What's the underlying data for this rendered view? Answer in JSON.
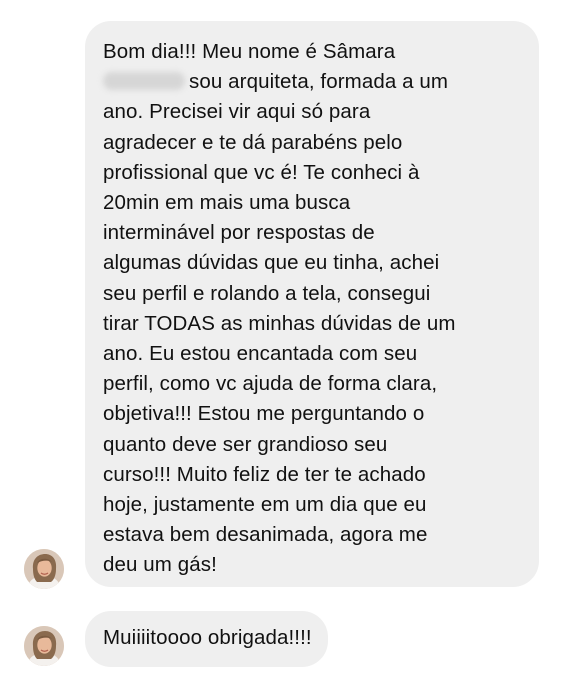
{
  "conversation": {
    "messages": [
      {
        "lines": [
          "Bom dia!!! Meu nome é Sâmara",
          "sou arquiteta, formada a um",
          "ano. Precisei vir aqui só para",
          "agradecer e te dá parabéns pelo",
          "profissional que vc é! Te conheci à",
          "20min em mais uma busca",
          "interminável por respostas de",
          "algumas dúvidas que eu tinha, achei",
          "seu perfil e rolando a tela, consegui",
          "tirar TODAS as minhas dúvidas de um",
          "ano. Eu estou encantada com seu",
          "perfil, como vc ajuda de forma clara,",
          "objetiva!!! Estou me perguntando o",
          "quanto deve ser grandioso seu",
          "curso!!! Muito feliz de ter te achado",
          "hoje, justamente em um dia que eu",
          "estava bem desanimada, agora me",
          "deu um gás!"
        ],
        "blurred_name_icon": "redacted-name"
      },
      {
        "text": "Muiiiitoooo obrigada!!!!"
      }
    ]
  },
  "colors": {
    "bubble": "#efefef",
    "text": "#111111",
    "background": "#ffffff"
  }
}
